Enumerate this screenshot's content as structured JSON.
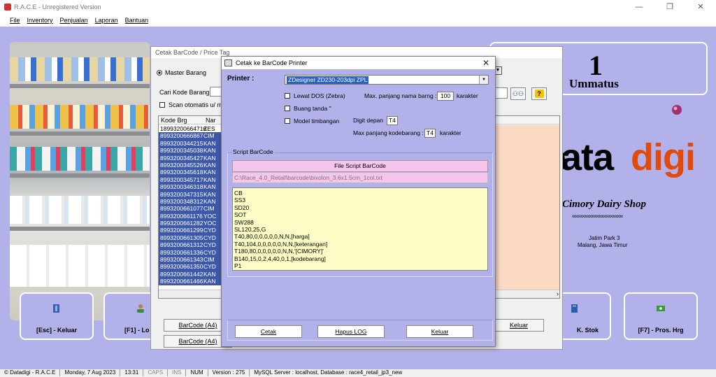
{
  "window": {
    "title": "R.A.C.E - Unregistered Version",
    "min": "—",
    "restore": "❐",
    "close": "✕"
  },
  "menu": [
    {
      "label": "File"
    },
    {
      "label": "Inventory"
    },
    {
      "label": "Penjualan"
    },
    {
      "label": "Laporan"
    },
    {
      "label": "Bantuan"
    }
  ],
  "info": {
    "number": "1",
    "name": "Ummatus"
  },
  "branding": {
    "logo_left": "ata",
    "logo_right": "digi",
    "shop": "Cimory Dairy Shop",
    "xline": "xxxxxxxxxxxxxxxxxxxxxxxxxxxxx",
    "addr1": "Jatim Park 3",
    "addr2": "Malang, Jawa Timur"
  },
  "bigbuttons": [
    {
      "label": "[Esc] - Keluar"
    },
    {
      "label": "[F1] - Lo"
    },
    {
      "label": "K. Stok"
    },
    {
      "label": "[F7] - Pros. Hrg"
    }
  ],
  "barcode_window": {
    "title": "Cetak BarCode / Price Tag",
    "radio": "Master Barang",
    "cari_label": "Cari Kode Barang :",
    "scan_label": "Scan otomatis u/ mas",
    "col_kode": "Kode Brg",
    "col_nama": "Nar",
    "rows": [
      {
        "kode": "18993200664716",
        "nama": "ZES"
      },
      {
        "kode": "8993200666867",
        "nama": "CIM"
      },
      {
        "kode": "8993200344215",
        "nama": "KAN"
      },
      {
        "kode": "8993200345038",
        "nama": "KAN"
      },
      {
        "kode": "8993200345427",
        "nama": "KAN"
      },
      {
        "kode": "8993200345526",
        "nama": "KAN"
      },
      {
        "kode": "8993200345618",
        "nama": "KAN"
      },
      {
        "kode": "8993200345717",
        "nama": "KAN"
      },
      {
        "kode": "8993200346318",
        "nama": "KAN"
      },
      {
        "kode": "8993200347315",
        "nama": "KAN"
      },
      {
        "kode": "8993200348312",
        "nama": "KAN"
      },
      {
        "kode": "8993200661077",
        "nama": "CIM"
      },
      {
        "kode": "8993200661176",
        "nama": "YOC"
      },
      {
        "kode": "8993200661282",
        "nama": "YOC"
      },
      {
        "kode": "8993200661299",
        "nama": "CYD"
      },
      {
        "kode": "8993200661305",
        "nama": "CYD"
      },
      {
        "kode": "8993200661312",
        "nama": "CYD"
      },
      {
        "kode": "8993200661336",
        "nama": "CYD"
      },
      {
        "kode": "8993200661343",
        "nama": "CIM"
      },
      {
        "kode": "8993200661350",
        "nama": "CYD"
      },
      {
        "kode": "8993200661442",
        "nama": "KAN"
      },
      {
        "kode": "8993200661466",
        "nama": "KAN"
      }
    ],
    "btn_barcode1": "BarCode (A4)",
    "btn_barcode2": "BarCode (A4)",
    "btn_keluar": "Keluar"
  },
  "printer_dialog": {
    "title": "Cetak ke BarCode Printer",
    "printer_label": "Printer :",
    "printer_value": "ZDesigner ZD230-203dpi ZPL",
    "lewat_dos": "Lewat DOS (Zebra)",
    "buang_tanda": "Buang tanda \"",
    "model_timbangan": "Model timbangan",
    "max_nama_label": "Max. panjang nama barng :",
    "max_nama_value": "100",
    "max_nama_unit": "karakter",
    "digit_depan_label": "Digit depan",
    "digit_depan_value": "T4",
    "max_kode_label": "Max panjang kodebarang :",
    "max_kode_value": "T4",
    "max_kode_unit": "karakter",
    "group_title": "Script BarCode",
    "file_script_btn": "File Script BarCode",
    "file_path": "C:\\Race_4.0_Retail\\barcode\\bixolon_3.6x1.5cm_1col.txt",
    "script_lines": [
      "CB",
      "SS3",
      "SD20",
      "SOT",
      "SW288",
      "SL120,25,G",
      "T40,80,0,0,0,0,0,N,N,[harga]",
      "T40,104,0,0,0,0,0,N,N,[keterangan]",
      "T180,80,0,0,0,0,0,N,N,'[CIMORY]'",
      "B140,15,0,2,4,40,0,1,[kodebarang]",
      "P1"
    ],
    "btn_cetak": "Cetak",
    "btn_hapus": "Hapus LOG",
    "btn_keluar": "Keluar"
  },
  "status": [
    "© Datadigi - R.A.C.E",
    "Monday, 7 Aug 2023",
    "13:31",
    "CAPS",
    "INS",
    "NUM",
    "Version : 275",
    "MySQL Server : localhost, Database : race4_retail_jp3_new"
  ]
}
